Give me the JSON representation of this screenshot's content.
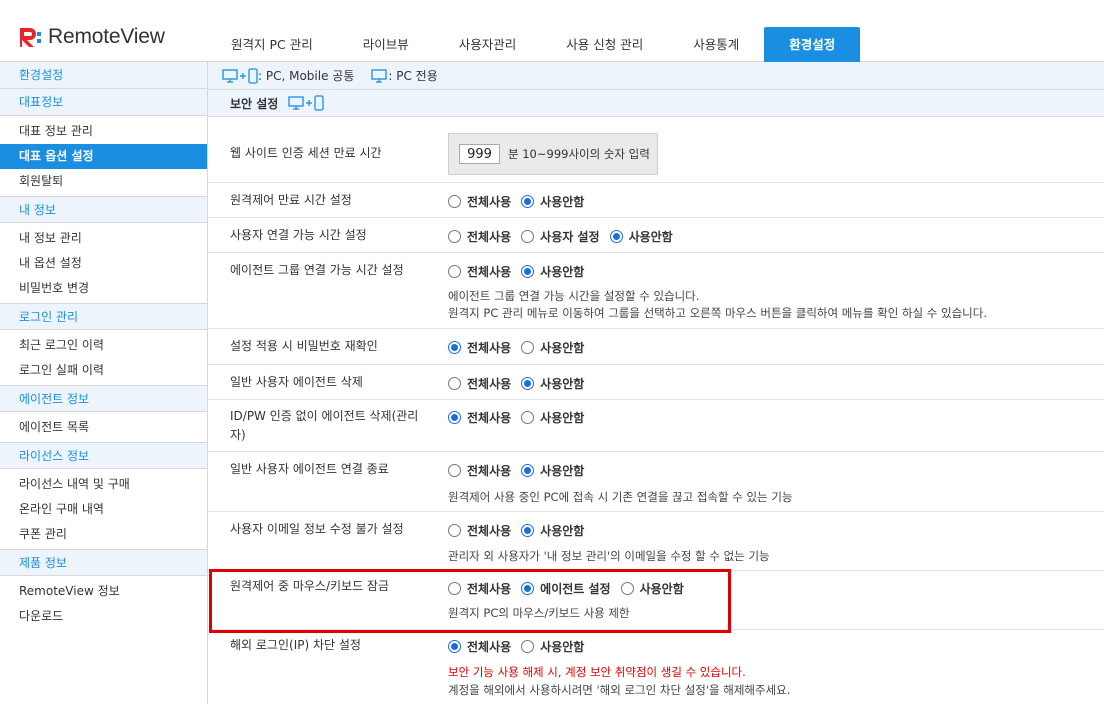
{
  "app": {
    "logo_text": "RemoteView"
  },
  "nav": {
    "items": [
      {
        "label": "원격지 PC 관리",
        "active": false
      },
      {
        "label": "라이브뷰",
        "active": false
      },
      {
        "label": "사용자관리",
        "active": false
      },
      {
        "label": "사용 신청 관리",
        "active": false
      },
      {
        "label": "사용통계",
        "active": false
      },
      {
        "label": "환경설정",
        "active": true
      }
    ]
  },
  "sidebar": {
    "header": "환경설정",
    "groups": [
      {
        "title": "대표정보",
        "items": [
          "대표 정보 관리",
          "대표 옵션 설정",
          "회원탈퇴"
        ]
      },
      {
        "title": "내 정보",
        "items": [
          "내 정보 관리",
          "내 옵션 설정",
          "비밀번호 변경"
        ]
      },
      {
        "title": "로그인 관리",
        "items": [
          "최근 로그인 이력",
          "로그인 실패 이력"
        ]
      },
      {
        "title": "에이전트 정보",
        "items": [
          "에이전트 목록"
        ]
      },
      {
        "title": "라이선스 정보",
        "items": [
          "라이선스 내역 및 구매",
          "온라인 구매 내역",
          "쿠폰 관리"
        ]
      },
      {
        "title": "제품 정보",
        "items": [
          "RemoteView 정보",
          "다운로드"
        ]
      }
    ],
    "active_item": "대표 옵션 설정"
  },
  "legend": {
    "common": ": PC, Mobile 공통",
    "pc_only": ": PC 전용"
  },
  "section": {
    "title": "보안 설정"
  },
  "settings": [
    {
      "label": "웹 사이트 인증 세션 만료 시간",
      "input_value": "999",
      "input_hint": "분 10~999사이의 숫자 입력"
    },
    {
      "label": "원격제어 만료 시간 설정",
      "options": [
        "전체사용",
        "사용안함"
      ],
      "selected": 1
    },
    {
      "label": "사용자 연결 가능 시간 설정",
      "options": [
        "전체사용",
        "사용자 설정",
        "사용안함"
      ],
      "selected": 2
    },
    {
      "label": "에이전트 그룹 연결 가능 시간 설정",
      "options": [
        "전체사용",
        "사용안함"
      ],
      "selected": 1,
      "desc": [
        "에이전트 그룹 연결 가능 시간을 설정할 수 있습니다.",
        "원격지 PC 관리 메뉴로 이동하여 그룹을 선택하고 오른쪽 마우스 버튼을 클릭하여 메뉴를 확인 하실 수 있습니다."
      ]
    },
    {
      "label": "설정 적용 시 비밀번호 재확인",
      "options": [
        "전체사용",
        "사용안함"
      ],
      "selected": 0
    },
    {
      "label": "일반 사용자 에이전트 삭제",
      "options": [
        "전체사용",
        "사용안함"
      ],
      "selected": 1
    },
    {
      "label": "ID/PW 인증 없이 에이전트 삭제(관리자)",
      "options": [
        "전체사용",
        "사용안함"
      ],
      "selected": 0
    },
    {
      "label": "일반 사용자 에이전트 연결 종료",
      "options": [
        "전체사용",
        "사용안함"
      ],
      "selected": 1,
      "desc": [
        "원격제어 사용 중인 PC에 접속 시 기존 연결을 끊고 접속할 수 있는 기능"
      ]
    },
    {
      "label": "사용자 이메일 정보 수정 불가 설정",
      "options": [
        "전체사용",
        "사용안함"
      ],
      "selected": 1,
      "desc": [
        "관리자 외 사용자가 '내 정보 관리'의 이메일을 수정 할 수 없는 기능"
      ]
    },
    {
      "label": "원격제어 중 마우스/키보드 잠금",
      "options": [
        "전체사용",
        "에이전트 설정",
        "사용안함"
      ],
      "selected": 1,
      "desc": [
        "원격지 PC의 마우스/키보드 사용 제한"
      ]
    },
    {
      "label": "해외 로그인(IP) 차단 설정",
      "options": [
        "전체사용",
        "사용안함"
      ],
      "selected": 0,
      "desc_red": "보안 기능 사용 해제 시, 계정 보안 취약점이 생길 수 있습니다.",
      "desc": [
        "계정을 해외에서 사용하시려면 '해외 로그인 차단 설정'을 해제해주세요."
      ]
    }
  ],
  "colors": {
    "accent": "#1a8ee1",
    "highlight": "#e00000",
    "panel": "#edf4fb"
  }
}
